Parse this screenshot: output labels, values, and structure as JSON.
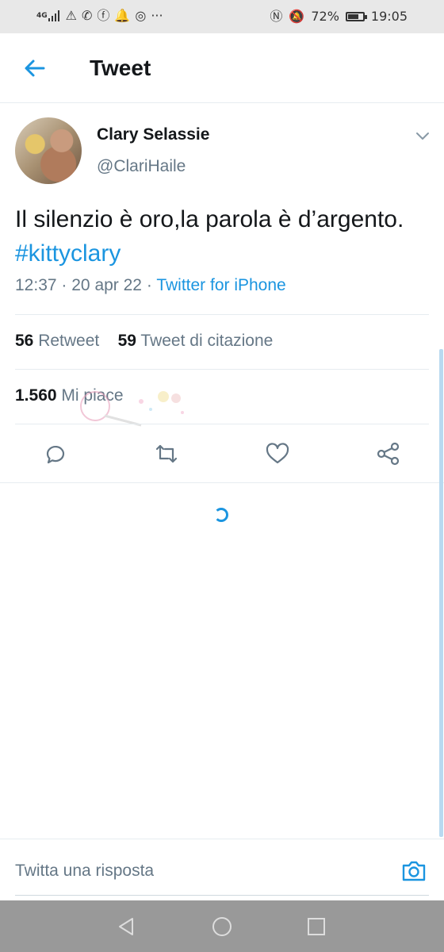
{
  "status_bar": {
    "network_label": "4G",
    "battery": "72%",
    "battery_level": 0.72,
    "time": "19:05",
    "left_glyphs": [
      "⚠",
      "✆",
      "ⓕ",
      "🔔",
      "◎",
      "···"
    ],
    "right_glyphs": [
      "Ⓝ",
      "🔕"
    ]
  },
  "header": {
    "title": "Tweet",
    "back_icon": "arrow-left-icon"
  },
  "tweet": {
    "author_name": "Clary Selassie",
    "author_handle": "@ClariHaile",
    "text": "Il silenzio è oro,la parola è d’argento. ",
    "hashtag": "#kittyclary",
    "time": "12:37",
    "date": "20 apr 22",
    "separator": "·",
    "source": "Twitter for iPhone",
    "retweets_count": "56",
    "retweets_label": "Retweet",
    "quotes_count": "59",
    "quotes_label": "Tweet di citazione",
    "likes_count": "1.560",
    "likes_label": "Mi piace"
  },
  "actions": [
    "reply-icon",
    "retweet-icon",
    "like-icon",
    "share-icon"
  ],
  "reply": {
    "placeholder": "Twitta una risposta",
    "camera_icon": "camera-icon"
  },
  "navbar": [
    "back-triangle-icon",
    "home-circle-icon",
    "recents-square-icon"
  ],
  "colors": {
    "accent": "#1b95e0",
    "secondary_text": "#657786",
    "status_bar_bg": "#e8e8e8",
    "nav_bar_bg": "#999999"
  }
}
